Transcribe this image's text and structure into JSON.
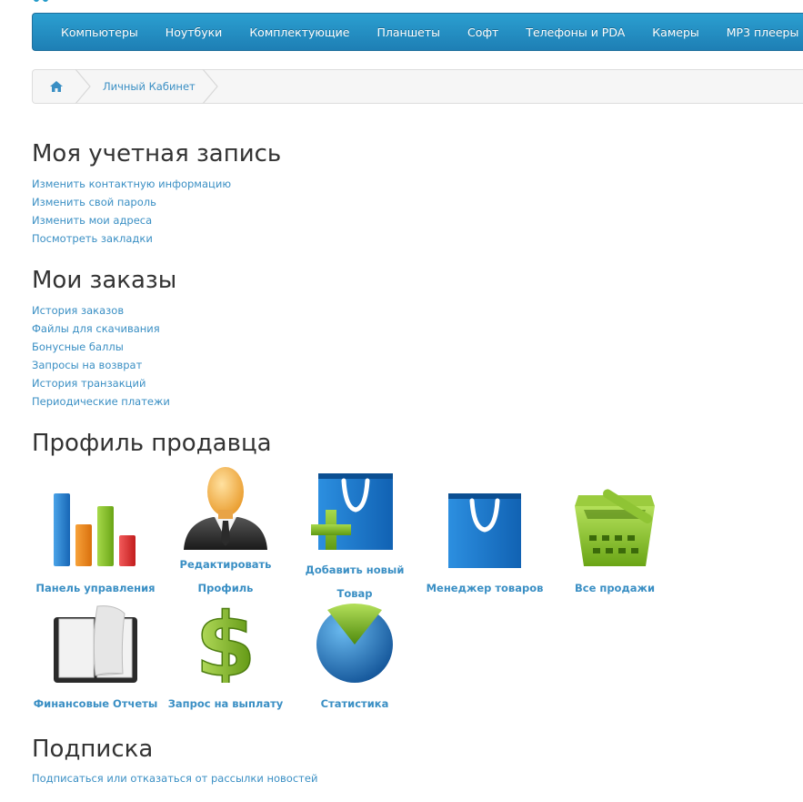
{
  "menu": {
    "items": [
      "Компьютеры",
      "Ноутбуки",
      "Комплектующие",
      "Планшеты",
      "Софт",
      "Телефоны и PDA",
      "Камеры",
      "MP3 плееры"
    ]
  },
  "breadcrumb": {
    "home_icon": "home-icon",
    "current": "Личный Кабинет"
  },
  "account": {
    "title": "Моя учетная запись",
    "links": [
      "Изменить контактную информацию",
      "Изменить свой пароль",
      "Изменить мои адреса",
      "Посмотреть закладки"
    ]
  },
  "orders": {
    "title": "Мои заказы",
    "links": [
      "История заказов",
      "Файлы для скачивания",
      "Бонусные баллы",
      "Запросы на возврат",
      "История транзакций",
      "Периодические платежи"
    ]
  },
  "seller": {
    "title": "Профиль продавца",
    "tiles": [
      {
        "label": "Панель управления",
        "icon": "bar-chart-icon"
      },
      {
        "label": "Редактировать Профиль",
        "icon": "user-profile-icon"
      },
      {
        "label": "Добавить новый Товар",
        "icon": "add-product-bag-icon"
      },
      {
        "label": "Менеджер товаров",
        "icon": "shopping-bag-icon"
      },
      {
        "label": "Все продажи",
        "icon": "basket-icon"
      },
      {
        "label": "Финансовые Отчеты",
        "icon": "book-icon"
      },
      {
        "label": "Запрос на выплату",
        "icon": "dollar-icon"
      },
      {
        "label": "Статистика",
        "icon": "pie-chart-icon"
      }
    ]
  },
  "subscription": {
    "title": "Подписка",
    "links": [
      "Подписаться или отказаться от рассылки новостей"
    ]
  },
  "colors": {
    "menu_bg": "#229ac8",
    "link": "#3a8fc4",
    "heading": "#333333"
  }
}
